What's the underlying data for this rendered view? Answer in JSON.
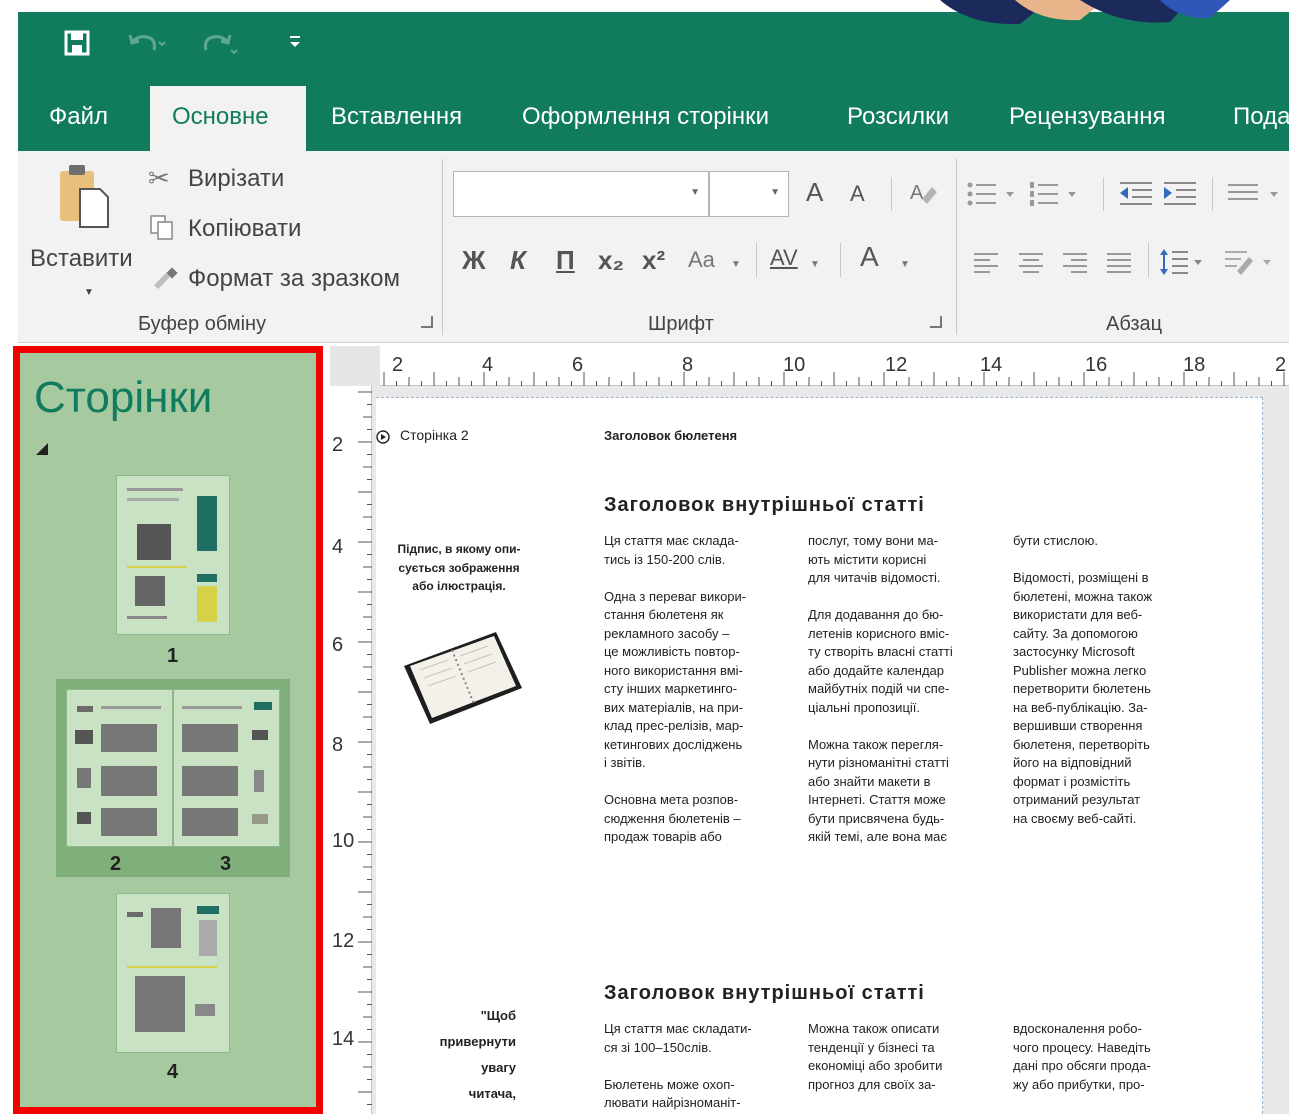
{
  "quick_access": {
    "save_icon": "save-icon",
    "undo_icon": "undo-icon",
    "redo_icon": "redo-icon",
    "customize_icon": "customize-qat-icon"
  },
  "tabs": [
    {
      "label": "Файл"
    },
    {
      "label": "Основне"
    },
    {
      "label": "Вставлення"
    },
    {
      "label": "Оформлення сторінки"
    },
    {
      "label": "Розсилки"
    },
    {
      "label": "Рецензування"
    },
    {
      "label": "Пода"
    }
  ],
  "clipboard": {
    "paste_label": "Вставити",
    "cut_label": "Вирізати",
    "copy_label": "Копіювати",
    "format_painter_label": "Формат за зразком",
    "group_label": "Буфер обміну"
  },
  "font": {
    "group_label": "Шрифт",
    "bold": "Ж",
    "italic": "К",
    "underline": "П",
    "subscript": "x₂",
    "superscript": "x²",
    "case": "Aa",
    "spacing": "AV",
    "color": "A",
    "grow": "A",
    "shrink": "A"
  },
  "paragraph": {
    "group_label": "Абзац"
  },
  "pages_pane": {
    "title": "Сторінки",
    "page_numbers": [
      "1",
      "2",
      "3",
      "4"
    ]
  },
  "ruler": {
    "h": [
      "2",
      "4",
      "6",
      "8",
      "10",
      "12",
      "14",
      "16",
      "18",
      "2"
    ],
    "v": [
      "2",
      "4",
      "6",
      "8",
      "10",
      "12",
      "14"
    ]
  },
  "document": {
    "page_marker": "Сторінка 2",
    "newsletter_heading": "Заголовок бюлетеня",
    "caption": "Підпис, в якому опи-\nсується зображення\nабо ілюстрація.",
    "article1": {
      "title": "Заголовок внутрішньої статті",
      "col1": "Ця стаття має склада-\nтись із 150-200 слів.\n\nОдна з переваг викори-\nстання бюлетеня як\nрекламного засобу –\nце можливість повтор-\nного використання вмі-\nсту інших маркетинго-\nвих матеріалів, на при-\nклад прес-релізів, мар-\nкетингових досліджень\nі звітів.\n\nОсновна мета розпов-\nсюдження бюлетенів –\nпродаж товарів або",
      "col2": "послуг, тому вони ма-\nють містити корисні\nдля читачів відомості.\n\nДля додавання до бю-\nлетенів корисного вміс-\nту створіть власні статті\nабо додайте календар\nмайбутніх подій чи спе-\nціальні пропозиції.\n\nМожна також перегля-\nнути різноманітні статті\nабо знайти макети в\nІнтернеті. Стаття може\nбути присвячена будь-\nякій темі, але вона має",
      "col3": "бути стислою.\n\nВідомості, розміщені в\nбюлетені, можна також\nвикористати для веб-\nсайту. За допомогою\nзастосунку Microsoft\nPublisher можна легко\nперетворити бюлетень\nна веб-публікацію. За-\nвершивши створення\nбюлетеня, перетворіть\nйого на відповідний\nформат і розмістіть\nотриманий результат\nна своєму веб-сайті."
    },
    "quote": "\"Щоб\nпривернути\nувагу\nчитача,",
    "article2": {
      "title": "Заголовок внутрішньої статті",
      "col1": "Ця стаття має складати-\nся зі 100–150слів.\n\nБюлетень може охоп-\nлювати найрізноманіт-",
      "col2": "Можна також описати\nтенденції у бізнесі та\nекономіці або зробити\nпрогноз для своїх за-",
      "col3": "вдосконалення робо-\nчого процесу. Наведіть\nдані про обсяги прода-\nжу або прибутки, про-"
    }
  }
}
